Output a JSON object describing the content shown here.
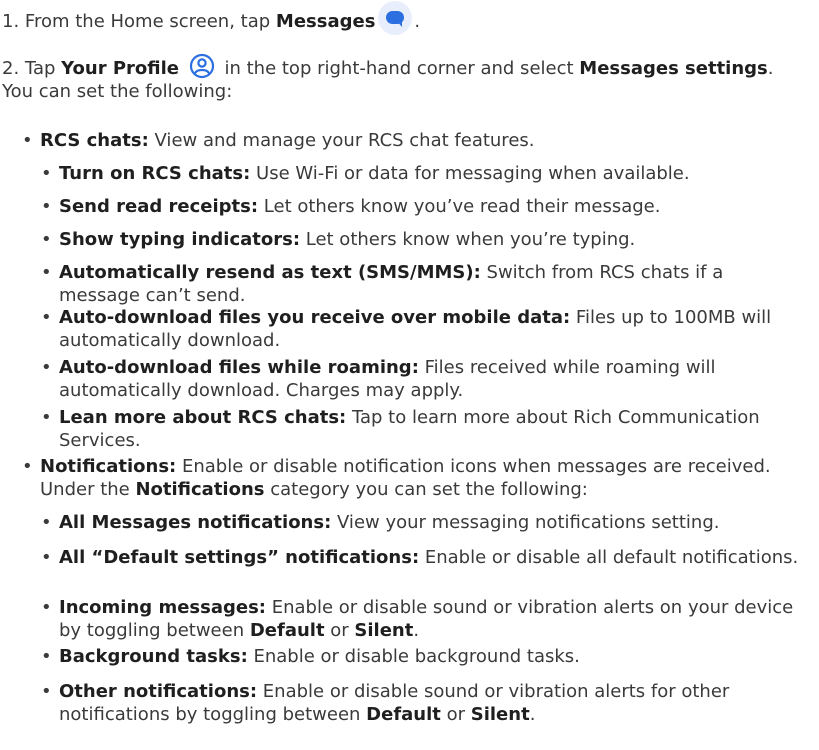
{
  "steps": [
    {
      "number": "1.",
      "prefix": "From the Home screen, tap",
      "bold": "Messages",
      "icon": "messages-app-icon",
      "suffix": "."
    },
    {
      "number": "2.",
      "part1": "Tap",
      "bold1": "Your Profile",
      "icon": "profile-icon",
      "part2": "in the top right-hand corner and select",
      "bold2": "Messages settings",
      "part3": ". You can set the following:"
    }
  ],
  "rcs": {
    "term": "RCS chats:",
    "desc": " View and manage your RCS chat features.",
    "items": [
      {
        "term": "Turn on RCS chats:",
        "desc": " Use Wi-Fi or data for messaging when available."
      },
      {
        "term": "Send read receipts:",
        "desc": " Let others know you’ve read their message."
      },
      {
        "term": "Show typing indicators:",
        "desc": " Let others know when you’re typing."
      },
      {
        "term": "Automatically resend as text (SMS/MMS):",
        "desc": " Switch from RCS chats if a message can’t send."
      },
      {
        "term": "Auto-download files you receive over mobile data:",
        "desc": " Files up to 100MB will automatically download."
      },
      {
        "term": "Auto-download files while roaming:",
        "desc": " Files received while roaming will automatically download. Charges may apply."
      },
      {
        "term": "Lean more about RCS chats:",
        "desc": " Tap to learn more about Rich Communication Services."
      }
    ]
  },
  "notifications": {
    "term": "Notifications:",
    "desc1": " Enable or disable notification icons when messages are received. Under the ",
    "bold": "Notifications",
    "desc2": " category you can set the following:",
    "items": [
      {
        "term": "All Messages notifications:",
        "desc": " View your messaging notifications setting."
      },
      {
        "term": "All “Default settings” notifications:",
        "desc": " Enable or disable all default notifications."
      },
      {
        "term": "Incoming messages:",
        "desc": " Enable or disable sound or vibration alerts on your device by toggling between ",
        "opt1": "Default",
        "or": " or ",
        "opt2": "Silent",
        "end": "."
      },
      {
        "term": "Background tasks:",
        "desc": " Enable or disable background tasks."
      },
      {
        "term": "Other notifications:",
        "desc": " Enable or disable sound or vibration alerts for other notifications by toggling between ",
        "opt1": "Default",
        "or": " or ",
        "opt2": "Silent",
        "end": "."
      }
    ]
  },
  "bullet_char": "•",
  "colors": {
    "text": "#3a3a3a",
    "bold": "#1f1f1f",
    "messages_icon_blue": "#2b6fe0",
    "messages_icon_bg": "#e8eefc",
    "profile_icon_blue": "#2b6fe0"
  }
}
